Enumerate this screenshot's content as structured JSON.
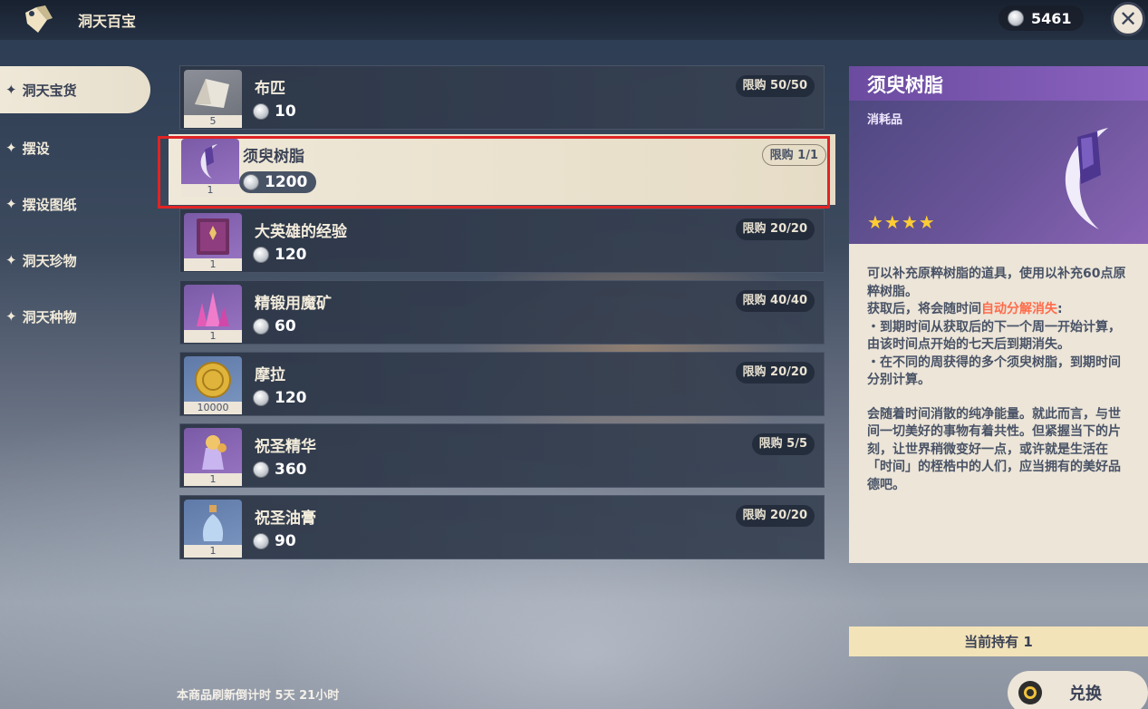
{
  "header": {
    "shop_title": "洞天百宝",
    "currency_amount": "5461",
    "close_symbol": "✕"
  },
  "sidebar": {
    "items": [
      {
        "label": "洞天宝货",
        "active": true
      },
      {
        "label": "摆设",
        "active": false
      },
      {
        "label": "摆设图纸",
        "active": false
      },
      {
        "label": "洞天珍物",
        "active": false
      },
      {
        "label": "洞天种物",
        "active": false
      }
    ],
    "star_symbol": "✦"
  },
  "items": [
    {
      "name": "布匹",
      "price": "10",
      "limit": "限购 50/50",
      "qty": "5",
      "icon": "cloth-icon"
    },
    {
      "name": "须臾树脂",
      "price": "1200",
      "limit": "限购 1/1",
      "qty": "1",
      "icon": "resin-icon",
      "selected": true
    },
    {
      "name": "大英雄的经验",
      "price": "120",
      "limit": "限购 20/20",
      "qty": "1",
      "icon": "book-icon"
    },
    {
      "name": "精锻用魔矿",
      "price": "60",
      "limit": "限购 40/40",
      "qty": "1",
      "icon": "crystal-ore-icon"
    },
    {
      "name": "摩拉",
      "price": "120",
      "limit": "限购 20/20",
      "qty": "10000",
      "icon": "mora-icon"
    },
    {
      "name": "祝圣精华",
      "price": "360",
      "limit": "限购 5/5",
      "qty": "1",
      "icon": "sanctifying-essence-icon"
    },
    {
      "name": "祝圣油膏",
      "price": "90",
      "limit": "限购 20/20",
      "qty": "1",
      "icon": "sanctifying-unction-icon"
    }
  ],
  "detail": {
    "title": "须臾树脂",
    "type": "消耗品",
    "stars": "★★★★",
    "desc_line1": "可以补充原粹树脂的道具，使用以补充60点原粹树脂。",
    "desc_line2_prefix": "获取后，将会随时间",
    "desc_line2_highlight": "自动分解消失",
    "desc_line2_suffix": ":",
    "desc_line3": "・到期时间从获取后的下一个周一开始计算，由该时间点开始的七天后到期消失。",
    "desc_line4": "・在不同的周获得的多个须臾树脂，到期时间分别计算。",
    "flavor": "会随着时间消散的纯净能量。就此而言，与世间一切美好的事物有着共性。但紧握当下的片刻，让世界稍微变好一点，或许就是生活在「时间」的桎梏中的人们，应当拥有的美好品德吧。",
    "highlight_color": "#ff6b4a"
  },
  "owned_text": "当前持有 1",
  "exchange_label": "兑换",
  "refresh_text": "本商品刷新倒计时 5天 21小时",
  "colors": {
    "accent_purple": "#8a62bf",
    "panel_cream": "#ece5d8",
    "highlight_red": "#e02424"
  }
}
